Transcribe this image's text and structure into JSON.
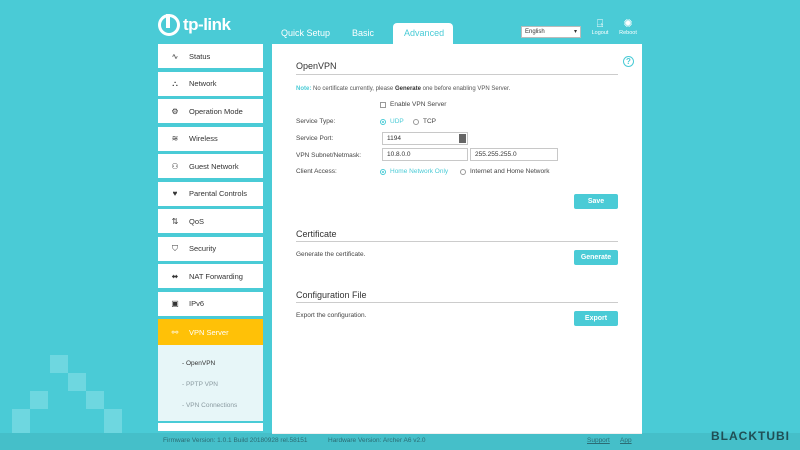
{
  "brand": {
    "logo": "tp-link"
  },
  "tabs": [
    {
      "label": "Quick Setup"
    },
    {
      "label": "Basic"
    },
    {
      "label": "Advanced"
    }
  ],
  "header": {
    "language": "English",
    "logout": "Logout",
    "reboot": "Reboot"
  },
  "sidebar": {
    "items": [
      {
        "label": "Status",
        "icon": "pulse-icon"
      },
      {
        "label": "Network",
        "icon": "network-icon"
      },
      {
        "label": "Operation Mode",
        "icon": "operation-mode-icon"
      },
      {
        "label": "Wireless",
        "icon": "wifi-icon"
      },
      {
        "label": "Guest Network",
        "icon": "guest-icon"
      },
      {
        "label": "Parental Controls",
        "icon": "heart-icon"
      },
      {
        "label": "QoS",
        "icon": "qos-icon"
      },
      {
        "label": "Security",
        "icon": "shield-icon"
      },
      {
        "label": "NAT Forwarding",
        "icon": "nat-icon"
      },
      {
        "label": "IPv6",
        "icon": "ipv6-icon"
      },
      {
        "label": "VPN Server",
        "icon": "link-icon"
      }
    ],
    "submenu": [
      {
        "label": "- OpenVPN"
      },
      {
        "label": "- PPTP VPN"
      },
      {
        "label": "- VPN Connections"
      }
    ]
  },
  "openvpn": {
    "title": "OpenVPN",
    "note_label": "Note:",
    "note_pre": " No certificate currently, please ",
    "note_bold": "Generate",
    "note_post": " one before enabling VPN Server.",
    "enable_label": "Enable VPN Server",
    "service_type_label": "Service Type:",
    "udp": "UDP",
    "tcp": "TCP",
    "service_port_label": "Service Port:",
    "service_port_value": "1194",
    "subnet_label": "VPN Subnet/Netmask:",
    "subnet_value": "10.8.0.0",
    "netmask_value": "255.255.255.0",
    "client_access_label": "Client Access:",
    "access_home": "Home Network Only",
    "access_internet": "Internet and Home Network",
    "save": "Save"
  },
  "certificate": {
    "title": "Certificate",
    "desc": "Generate the certificate.",
    "button": "Generate"
  },
  "config_file": {
    "title": "Configuration File",
    "desc": "Export the configuration.",
    "button": "Export"
  },
  "footer": {
    "firmware": "Firmware Version: 1.0.1 Build 20180928 rel.58151",
    "hardware": "Hardware Version: Archer A6 v2.0",
    "support": "Support",
    "app": "App"
  },
  "watermark": "BLACKTUBI",
  "colors": {
    "accent": "#4acbd6",
    "active": "#ffc107",
    "background": "#4acbd6"
  }
}
